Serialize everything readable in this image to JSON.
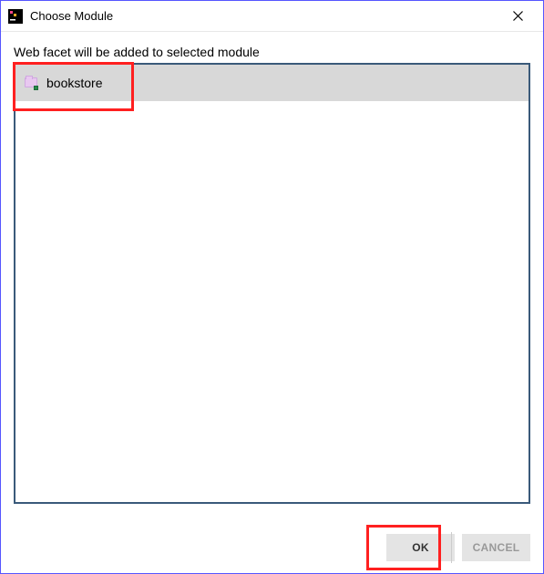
{
  "titlebar": {
    "title": "Choose Module"
  },
  "description": "Web facet will be added to selected module",
  "modules": [
    {
      "label": "bookstore"
    }
  ],
  "buttons": {
    "ok": "OK",
    "cancel": "CANCEL"
  }
}
